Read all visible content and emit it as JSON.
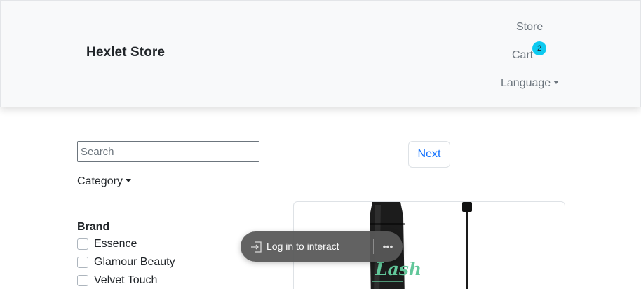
{
  "navbar": {
    "brand": "Hexlet Store",
    "links": {
      "store": "Store",
      "cart": "Cart",
      "cart_count": "2",
      "language": "Language"
    }
  },
  "sidebar": {
    "search": {
      "placeholder": "Search",
      "value": ""
    },
    "category_label": "Category",
    "brand_heading": "Brand",
    "brands": [
      {
        "label": "Essence",
        "checked": false
      },
      {
        "label": "Glamour Beauty",
        "checked": false
      },
      {
        "label": "Velvet Touch",
        "checked": false
      }
    ]
  },
  "pagination": {
    "next_label": "Next"
  },
  "product_card": {
    "image_text": "Lash"
  },
  "overlay": {
    "login_label": "Log in to interact",
    "more_icon": "more-dots-icon",
    "login_icon": "sign-in-icon"
  },
  "colors": {
    "navbar_bg": "#f8f9fa",
    "badge": "#0dcaf0",
    "link_primary": "#0d6efd",
    "overlay_bg": "#585858"
  }
}
